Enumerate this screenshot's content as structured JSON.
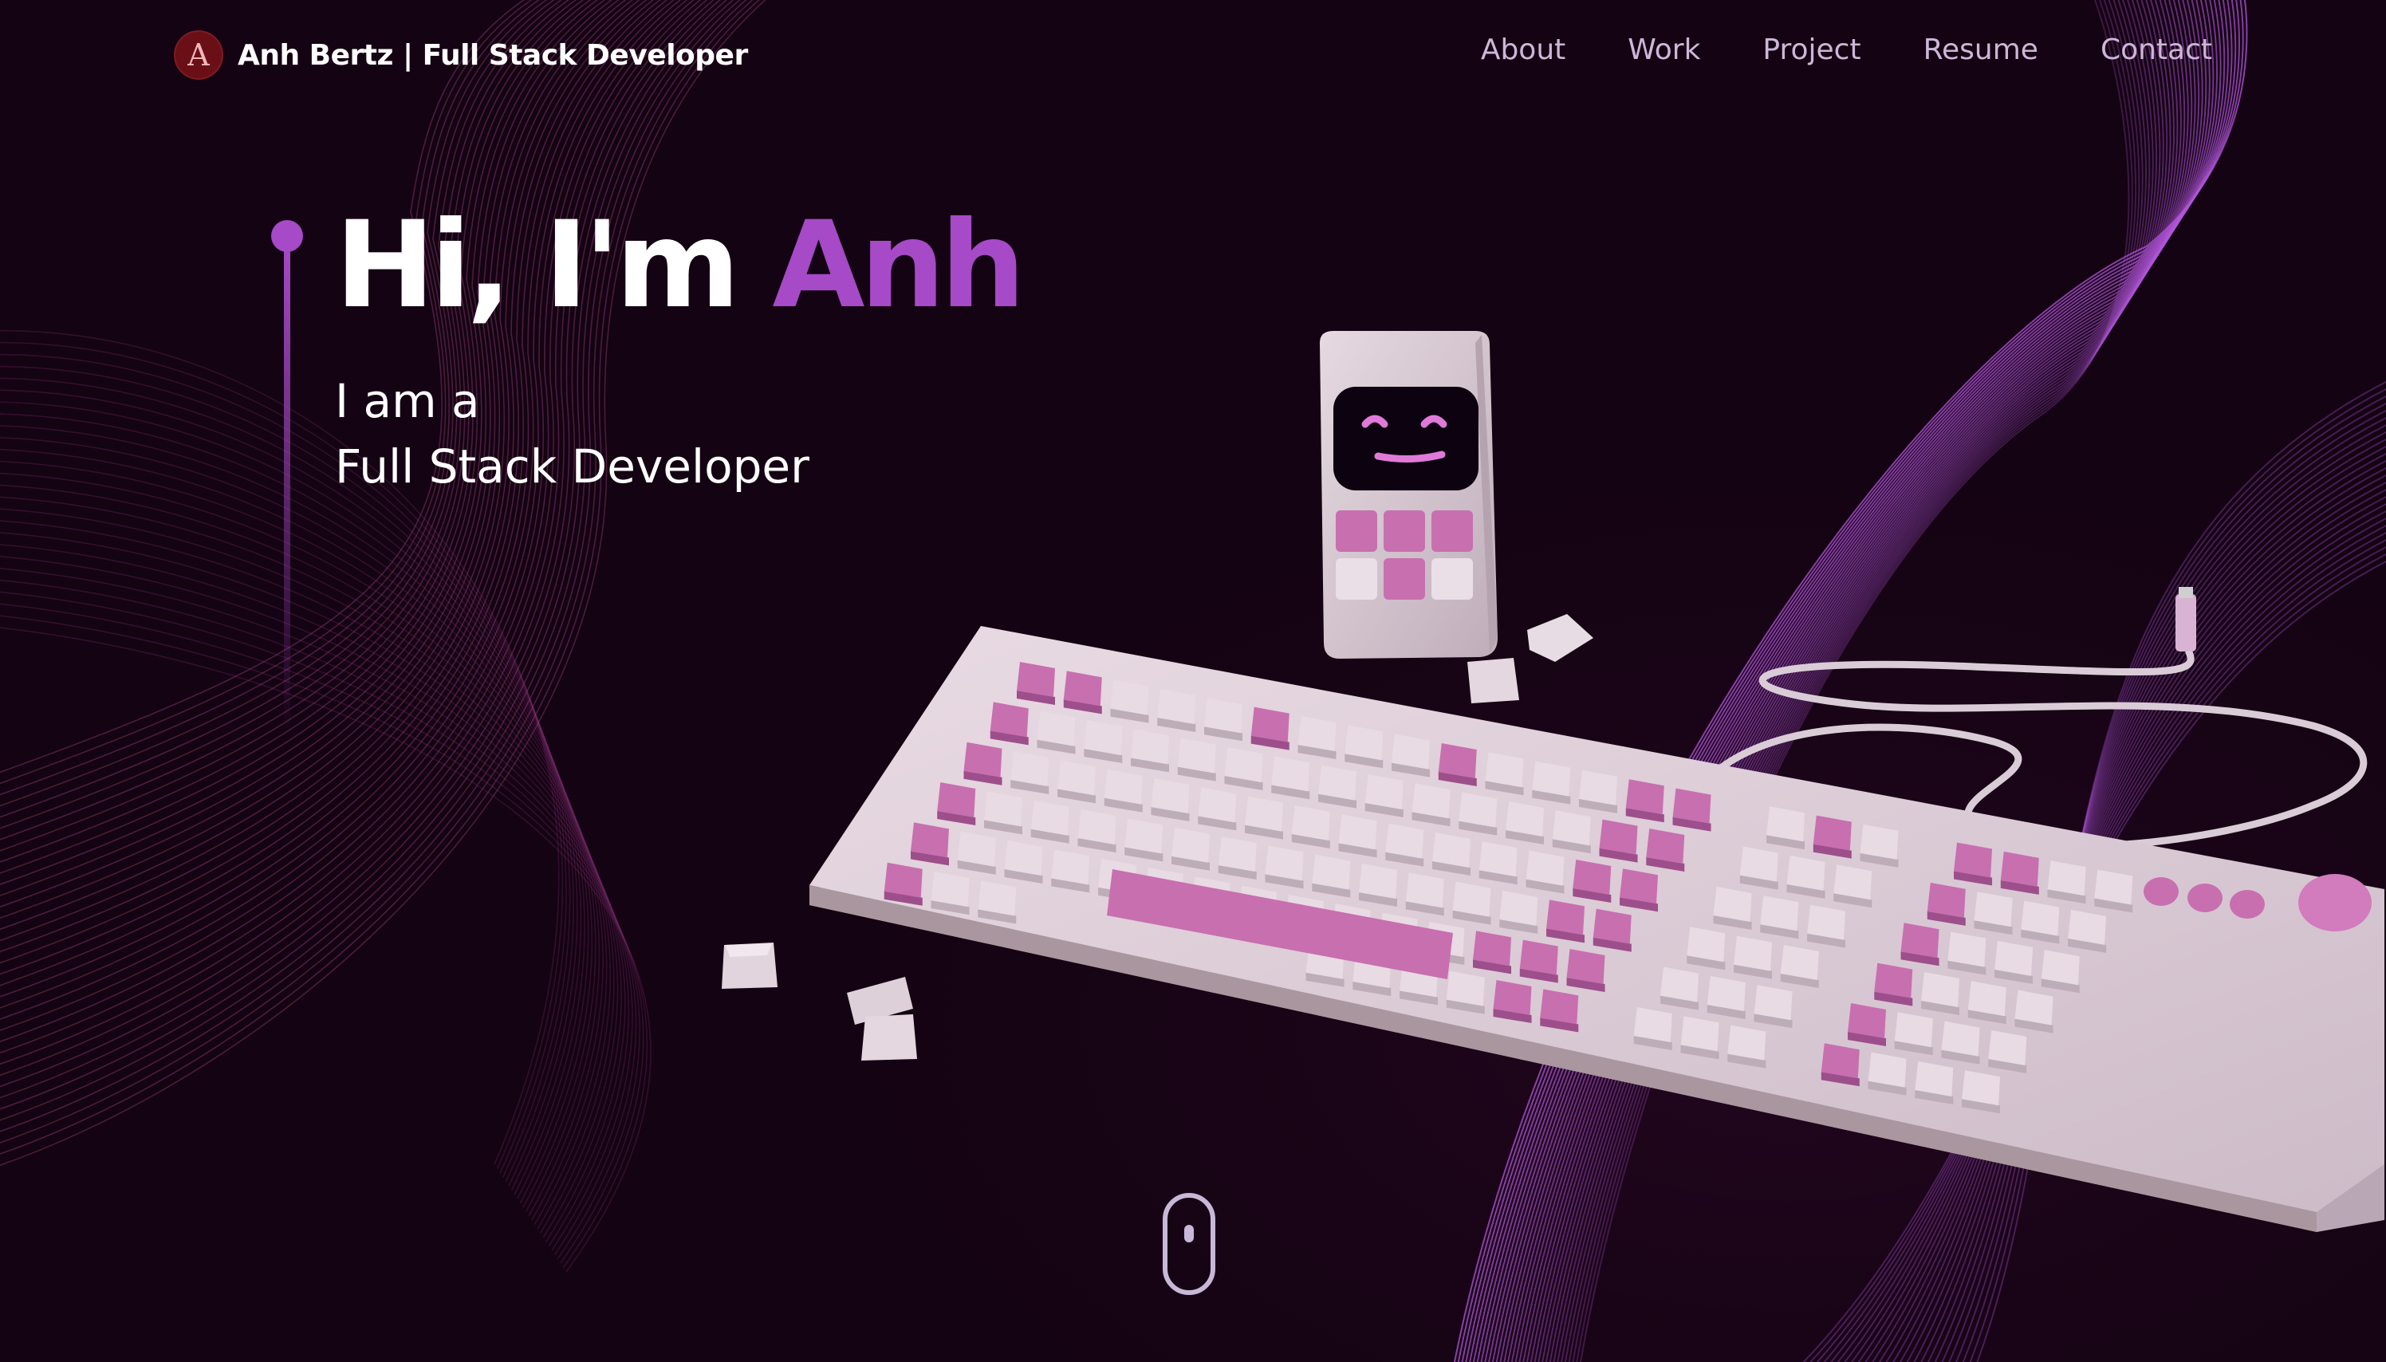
{
  "brand": {
    "logo_letter": "A",
    "title": "Anh Bertz  | Full Stack Developer"
  },
  "nav": {
    "items": [
      {
        "label": "About"
      },
      {
        "label": "Work"
      },
      {
        "label": "Project"
      },
      {
        "label": "Resume"
      },
      {
        "label": "Contact"
      }
    ]
  },
  "hero": {
    "greeting_prefix": "Hi, I'm ",
    "greeting_name": "Anh",
    "subtitle_line1": "I am a",
    "subtitle_line2": "Full Stack Developer"
  },
  "icons": {
    "scroll": "mouse-scroll-icon",
    "logo": "angular-logo-icon"
  },
  "colors": {
    "background": "#180416",
    "accent": "#a64ac8",
    "nav_text": "#cdb6d8",
    "keycap_pink": "#c86fb0",
    "keycap_white": "#e8dbe3"
  }
}
